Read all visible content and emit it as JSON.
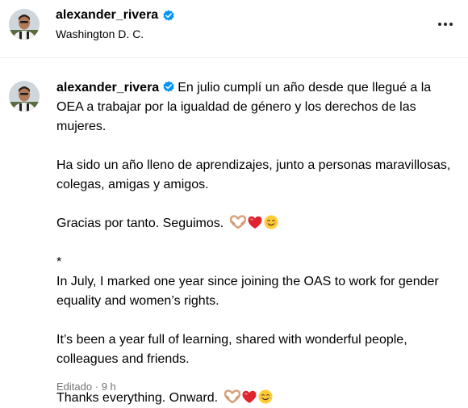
{
  "header": {
    "username": "alexander_rivera",
    "location": "Washington D. C.",
    "verified_icon": "verified-badge-icon",
    "more_icon": "more-options-icon"
  },
  "post": {
    "username": "alexander_rivera",
    "paragraphs": [
      "En julio cumplí un año desde que llegué a la OEA a trabajar por la igualdad de género y los derechos de las mujeres.",
      "Ha sido un año lleno de aprendizajes, junto a personas maravillosas, colegas, amigas y amigos.",
      "Gracias por tanto. Seguimos.",
      "*",
      "In July, I marked one year since joining the OAS to work for gender equality and women’s rights.",
      "It’s been a year full of learning, shared with wonderful people, colleagues and friends.",
      "Thanks everything. Onward."
    ],
    "emojis": [
      "heart-hands-emoji",
      "red-heart-emoji",
      "smiling-face-emoji"
    ],
    "edited_label": "Editado",
    "separator": "·",
    "time_ago": "9 h"
  },
  "colors": {
    "verified_blue": "#0095f6",
    "meta_gray": "#737373",
    "divider": "#efefef"
  }
}
